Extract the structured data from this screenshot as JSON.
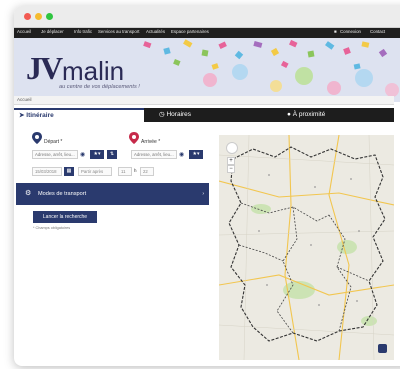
{
  "nav": {
    "items": [
      "Accueil",
      "Je déplacer",
      "Info trafic",
      "Services au transport",
      "Actualités",
      "Espace partenaires"
    ],
    "right_account": "Connexion",
    "right_contact": "Contact"
  },
  "brand": {
    "logo_j": "JV",
    "logo_text": "malin",
    "tagline": "au centre de vos déplacements !"
  },
  "breadcrumb": "Accueil",
  "tabs": [
    {
      "label": "Itinéraire",
      "icon": "route-icon"
    },
    {
      "label": "Horaires",
      "icon": "clock-icon"
    },
    {
      "label": "À proximité",
      "icon": "pin-icon"
    }
  ],
  "form": {
    "depart_label": "Départ *",
    "arrivee_label": "Arrivée *",
    "depart_placeholder": "Adresse, arrêt, lieu...",
    "arrivee_placeholder": "Adresse, arrêt, lieu...",
    "date_value": "15/03/2018",
    "time_mode": "Partir après",
    "hour": "11",
    "minute": "22",
    "modes_label": "Modes de transport",
    "search_label": "Lancer la recherche",
    "required_note": "* Champs obligatoires"
  },
  "colors": {
    "primary": "#2a3a6e",
    "nav_bg": "#1f1f1f",
    "depart_pin": "#2a3a6e",
    "arrivee_pin": "#c62a4a"
  }
}
